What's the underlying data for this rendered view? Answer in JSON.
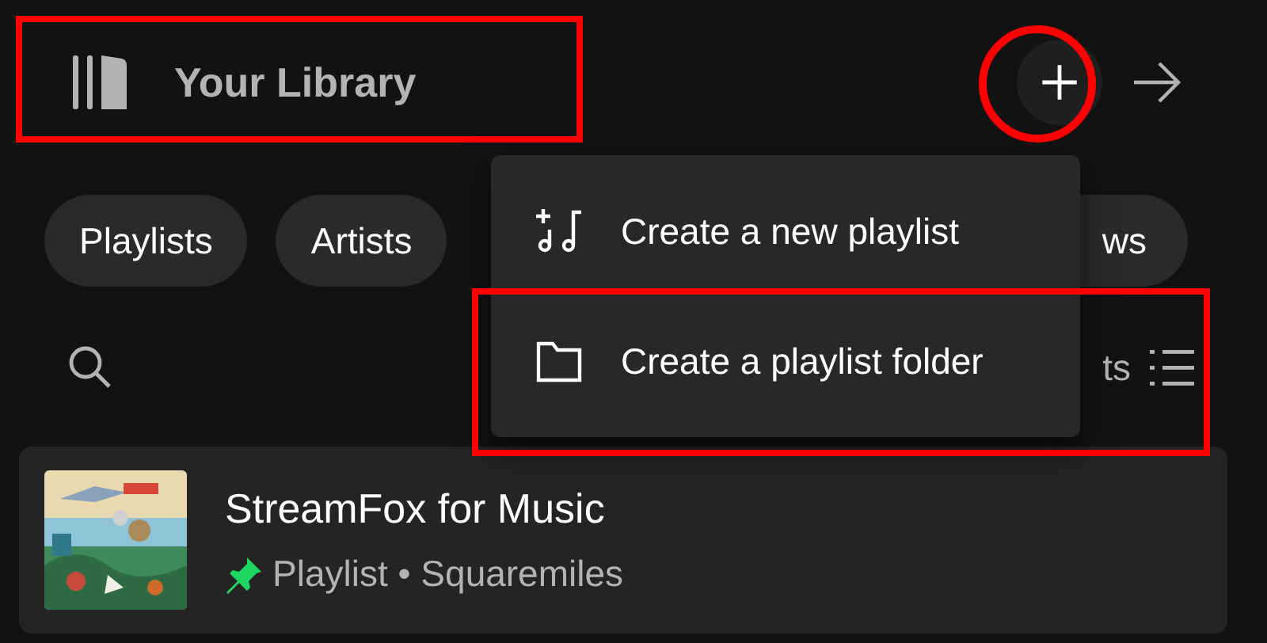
{
  "header": {
    "title": "Your Library"
  },
  "filters": [
    {
      "label": "Playlists"
    },
    {
      "label": "Artists"
    },
    {
      "label": "ws"
    }
  ],
  "sort": {
    "label": "ts"
  },
  "menu": {
    "items": [
      {
        "kind": "playlist",
        "label": "Create a new playlist"
      },
      {
        "kind": "folder",
        "label": "Create a playlist folder"
      }
    ]
  },
  "playlist": {
    "title": "StreamFox for Music",
    "subtitle": "Playlist • Squaremiles",
    "pinned": true
  }
}
